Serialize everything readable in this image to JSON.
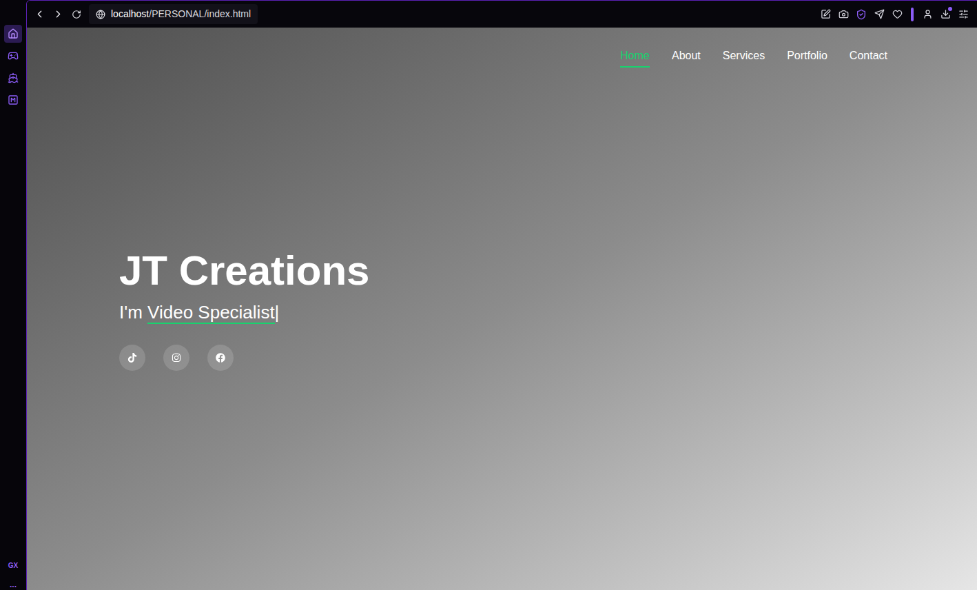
{
  "browser": {
    "url_host": "localhost",
    "url_path": "/PERSONAL/index.html",
    "sidebar": {
      "items": [
        {
          "kind": "home",
          "selected": true
        },
        {
          "kind": "games",
          "selected": false
        },
        {
          "kind": "ship",
          "selected": false
        },
        {
          "kind": "m",
          "selected": false
        }
      ],
      "footer_label": "GX",
      "more_label": "..."
    }
  },
  "page": {
    "nav": [
      {
        "label": "Home",
        "selected": true
      },
      {
        "label": "About",
        "selected": false
      },
      {
        "label": "Services",
        "selected": false
      },
      {
        "label": "Portfolio",
        "selected": false
      },
      {
        "label": "Contact",
        "selected": false
      }
    ],
    "hero": {
      "title": "JT Creations",
      "subtitle_prefix": "I'm ",
      "subtitle_typed": "Video Specialist",
      "cursor": "|"
    },
    "social": [
      {
        "kind": "tiktok"
      },
      {
        "kind": "instagram"
      },
      {
        "kind": "facebook"
      }
    ]
  }
}
